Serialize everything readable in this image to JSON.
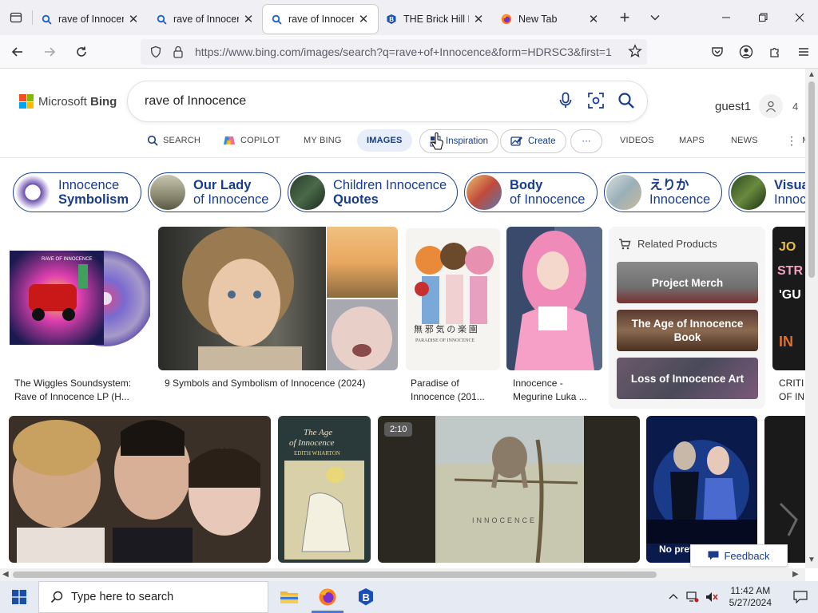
{
  "browser": {
    "tabs": [
      {
        "title": "rave of Innocence",
        "icon": "search-icon"
      },
      {
        "title": "rave of Innocence",
        "icon": "search-icon"
      },
      {
        "title": "rave of Innocence",
        "icon": "search-icon",
        "active": true
      },
      {
        "title": "THE Brick Hill Hub",
        "icon": "brickhill-icon"
      },
      {
        "title": "New Tab",
        "icon": "firefox-icon"
      }
    ],
    "url": "https://www.bing.com/images/search?q=rave+of+Innocence&form=HDRSC3&first=1"
  },
  "bing": {
    "logo_brand": "Microsoft",
    "logo_product": "Bing",
    "query": "rave of Innocence",
    "user": "guest1",
    "rewards_count": "4",
    "colors": {
      "ms_red": "#f25022",
      "ms_green": "#7fba00",
      "ms_blue": "#00a4ef",
      "ms_yellow": "#ffb900",
      "accent": "#1a3c8c"
    }
  },
  "scopes": {
    "search": "SEARCH",
    "copilot": "COPILOT",
    "mybing": "MY BING",
    "images": "IMAGES",
    "inspiration": "Inspiration",
    "create": "Create",
    "more": "···",
    "videos": "VIDEOS",
    "maps": "MAPS",
    "news": "NEWS",
    "cut": "MO"
  },
  "chips": [
    {
      "line1": "Innocence",
      "line2": "Symbolism",
      "bold": 2
    },
    {
      "line1": "Our Lady",
      "line2": "of Innocence",
      "bold": 1
    },
    {
      "line1": "Children Innocence",
      "line2": "Quotes",
      "bold": 2
    },
    {
      "line1": "Body",
      "line2": "of Innocence",
      "bold": 1
    },
    {
      "line1": "えりか",
      "line2": "Innocence",
      "bold": 1
    },
    {
      "line1": "Visual",
      "line2": "Innoc",
      "bold": 1
    }
  ],
  "results": {
    "row1": [
      {
        "caption1": "The Wiggles Soundsystem:",
        "caption2": "Rave of Innocence LP (H..."
      },
      {
        "caption1": "9 Symbols and Symbolism of Innocence (2024)",
        "caption2": ""
      },
      {
        "caption1": "Paradise of",
        "caption2": "Innocence (201..."
      },
      {
        "caption1": "Innocence -",
        "caption2": "Megurine Luka ..."
      },
      {
        "caption1": "CRITI",
        "caption2": "OF IN"
      }
    ],
    "video_duration": "2:10",
    "no_preview": "No prev"
  },
  "related": {
    "heading": "Related Products",
    "items": [
      "Project Merch",
      "The Age of Innocence Book",
      "Loss of Innocence Art"
    ]
  },
  "feedback": "Feedback",
  "taskbar": {
    "search_placeholder": "Type here to search",
    "time": "11:42 AM",
    "date": "5/27/2024"
  }
}
